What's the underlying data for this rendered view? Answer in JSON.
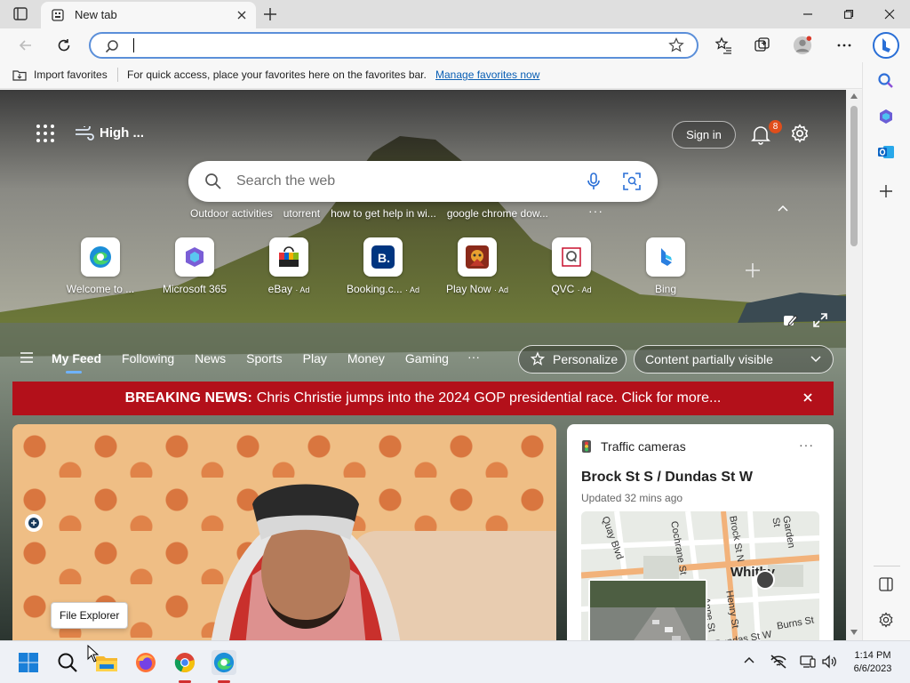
{
  "browser": {
    "tab_title": "New tab",
    "address_placeholder": "",
    "favorites_bar": {
      "import_label": "Import favorites",
      "message": "For quick access, place your favorites here on the favorites bar.",
      "manage_link": "Manage favorites now"
    }
  },
  "newtab": {
    "weather": "High ...",
    "sign_in": "Sign in",
    "notification_count": "8",
    "search_placeholder": "Search the web",
    "suggestions": [
      "Outdoor activities",
      "utorrent",
      "how to get help in wi...",
      "google chrome dow..."
    ],
    "quick_links": [
      {
        "label": "Welcome to ...",
        "ad": "",
        "icon": "edge-icon"
      },
      {
        "label": "Microsoft 365",
        "ad": "",
        "icon": "microsoft365-icon"
      },
      {
        "label": "eBay",
        "ad": "· Ad",
        "icon": "ebay-icon"
      },
      {
        "label": "Booking.c...",
        "ad": "· Ad",
        "icon": "booking-icon"
      },
      {
        "label": "Play Now",
        "ad": "· Ad",
        "icon": "play-now-icon"
      },
      {
        "label": "QVC",
        "ad": "· Ad",
        "icon": "qvc-icon"
      },
      {
        "label": "Bing",
        "ad": "",
        "icon": "bing-icon"
      }
    ],
    "feed_tabs": [
      "My Feed",
      "Following",
      "News",
      "Sports",
      "Play",
      "Money",
      "Gaming"
    ],
    "feed_more": "···",
    "personalize": "Personalize",
    "content_visibility": "Content partially visible",
    "breaking_news": {
      "prefix": "BREAKING NEWS:",
      "text": "Chris Christie jumps into the 2024 GOP presidential race. Click for more..."
    },
    "traffic_card": {
      "header": "Traffic cameras",
      "location": "Brock St S / Dundas St W",
      "updated": "Updated 32 mins ago",
      "map_labels": [
        "Quay Blvd",
        "Cochrane St",
        "Brock St N",
        "Garden St",
        "Whitby",
        "Henry St",
        "Anne St",
        "Dundas St W",
        "Burns St"
      ]
    },
    "tooltip": "File Explorer"
  },
  "taskbar": {
    "time": "1:14 PM",
    "date": "6/6/2023"
  },
  "colors": {
    "accent": "#0a5fb4",
    "breaking": "#b3101a",
    "badge": "#e04e1b"
  }
}
